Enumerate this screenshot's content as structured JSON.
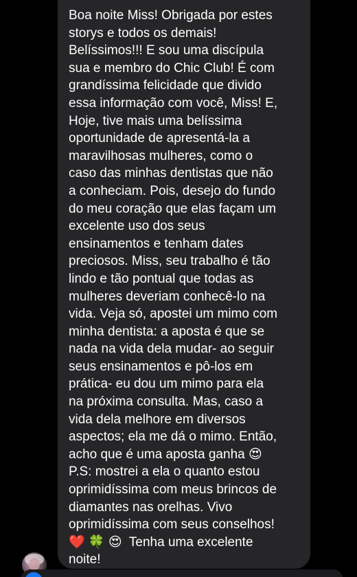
{
  "conversation": {
    "message": {
      "text": "Boa noite Miss! Obrigada por estes\nstorys e todos os demais!\nBelíssimos!!! E sou uma discípula\nsua e membro do Chic Club! É com\ngrandíssima felicidade que divido\nessa informação com você, Miss! E,\nHoje, tive mais uma belíssima\noportunidade de apresentá-la a\nmaravilhosas mulheres, como o\ncaso das minhas dentistas que não\na conheciam. Pois, desejo do fundo\ndo meu coração que elas façam um\nexcelente uso dos seus\nensinamentos e tenham dates\npreciosos. Miss, seu trabalho é tão\nlindo e tão pontual que todas as\nmulheres deveriam conhecê-lo na\nvida. Veja só, apostei um mimo com\nminha dentista: a aposta é que se\nnada na vida dela mudar- ao seguir\nseus ensinamentos e pô-los em\nprática- eu dou um mimo para ela\nna próxima consulta. Mas, caso a\nvida dela melhore em diversos\naspectos; ela me dá o mimo. Então,\nacho que é uma aposta ganha 😍\nP.S: mostrei a ela o quanto estou\noprimidíssima com meus brincos de\ndiamantes nas orelhas. Vivo\noprimidíssima com seus conselhos!\n❤️ 🍀 😍  Tenha uma excelente\nnoite!"
    },
    "sender": {
      "avatar_icon": "profile-photo"
    },
    "colors": {
      "background": "#000000",
      "bubble": "#262628",
      "text": "#ffffff"
    }
  }
}
